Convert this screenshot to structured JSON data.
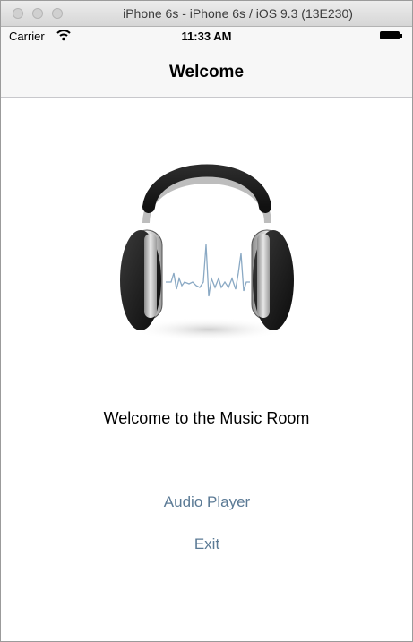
{
  "window": {
    "title": "iPhone 6s - iPhone 6s / iOS 9.3 (13E230)"
  },
  "statusbar": {
    "carrier": "Carrier",
    "time": "11:33 AM"
  },
  "navbar": {
    "title": "Welcome"
  },
  "main": {
    "welcome_text": "Welcome to the Music Room",
    "audio_player_label": "Audio Player",
    "exit_label": "Exit"
  },
  "icons": {
    "window_controls": [
      "close-icon",
      "minimize-icon",
      "zoom-icon"
    ],
    "status": [
      "wifi-icon",
      "battery-icon"
    ],
    "logo": "headphones-icon"
  },
  "colors": {
    "link": "#5b7a95",
    "navbar_bg": "#f7f7f7"
  }
}
